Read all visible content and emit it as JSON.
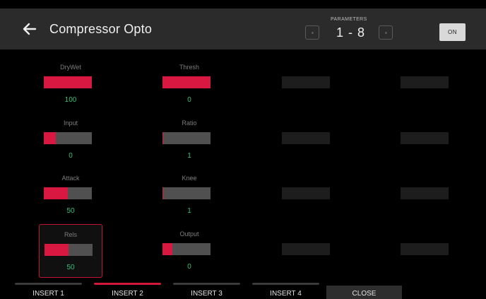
{
  "header": {
    "title": "Compressor Opto",
    "parameters_label": "PARAMETERS",
    "parameters_range": "1 - 8",
    "on_label": "ON"
  },
  "colors": {
    "accent": "#d81840",
    "value_text": "#3dbf7a",
    "bar_track": "#505050",
    "empty_slot": "#1d1d1d"
  },
  "parameters": [
    {
      "label": "DryWet",
      "value": "100",
      "level": 1.0
    },
    {
      "label": "Thresh",
      "value": "0",
      "level": 1.0
    },
    {
      "label": "Input",
      "value": "0",
      "level": 0.25
    },
    {
      "label": "Ratio",
      "value": "1",
      "level": 0.02
    },
    {
      "label": "Attack",
      "value": "50",
      "level": 0.5
    },
    {
      "label": "Knee",
      "value": "1",
      "level": 0.02
    },
    {
      "label": "Rels",
      "value": "50",
      "level": 0.5,
      "selected": true
    },
    {
      "label": "Output",
      "value": "0",
      "level": 0.2
    }
  ],
  "tabs": [
    {
      "label": "INSERT 1",
      "active": false
    },
    {
      "label": "INSERT 2",
      "active": true
    },
    {
      "label": "INSERT 3",
      "active": false
    },
    {
      "label": "INSERT 4",
      "active": false
    }
  ],
  "close_label": "CLOSE"
}
